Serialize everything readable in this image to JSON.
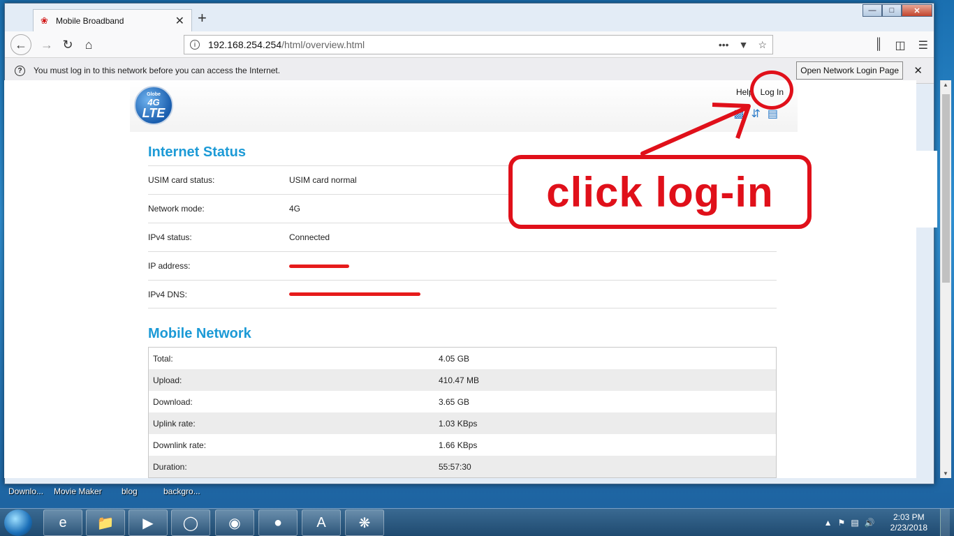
{
  "desktop": {
    "icons": [
      "Downlo...",
      "Movie Maker",
      "blog",
      "backgro..."
    ]
  },
  "browser": {
    "tab_title": "Mobile Broadband",
    "url_host": "192.168.254.254",
    "url_path": "/html/overview.html",
    "notification_text": "You must log in to this network before you can access the Internet.",
    "notification_button": "Open Network Login Page"
  },
  "page": {
    "logo_small": "Globe",
    "logo_mid": "4G",
    "logo_big": "LTE",
    "help_link": "Help",
    "login_link": "Log In",
    "internet_status_title": "Internet Status",
    "status_rows": [
      {
        "label": "USIM card status:",
        "value": "USIM card normal"
      },
      {
        "label": "Network mode:",
        "value": "4G"
      },
      {
        "label": "IPv4 status:",
        "value": "Connected"
      },
      {
        "label": "IP address:",
        "value": ""
      },
      {
        "label": "IPv4 DNS:",
        "value": ""
      }
    ],
    "mobile_network_title": "Mobile Network",
    "network_rows": [
      {
        "label": "Total:",
        "value": "4.05 GB"
      },
      {
        "label": "Upload:",
        "value": "410.47 MB"
      },
      {
        "label": "Download:",
        "value": "3.65 GB"
      },
      {
        "label": "Uplink rate:",
        "value": "1.03 KBps"
      },
      {
        "label": "Downlink rate:",
        "value": "1.66 KBps"
      },
      {
        "label": "Duration:",
        "value": "55:57:30"
      }
    ]
  },
  "annotation": {
    "text": "click log-in",
    "color": "#e0101a"
  },
  "taskbar": {
    "time": "2:03 PM",
    "date": "2/23/2018"
  }
}
